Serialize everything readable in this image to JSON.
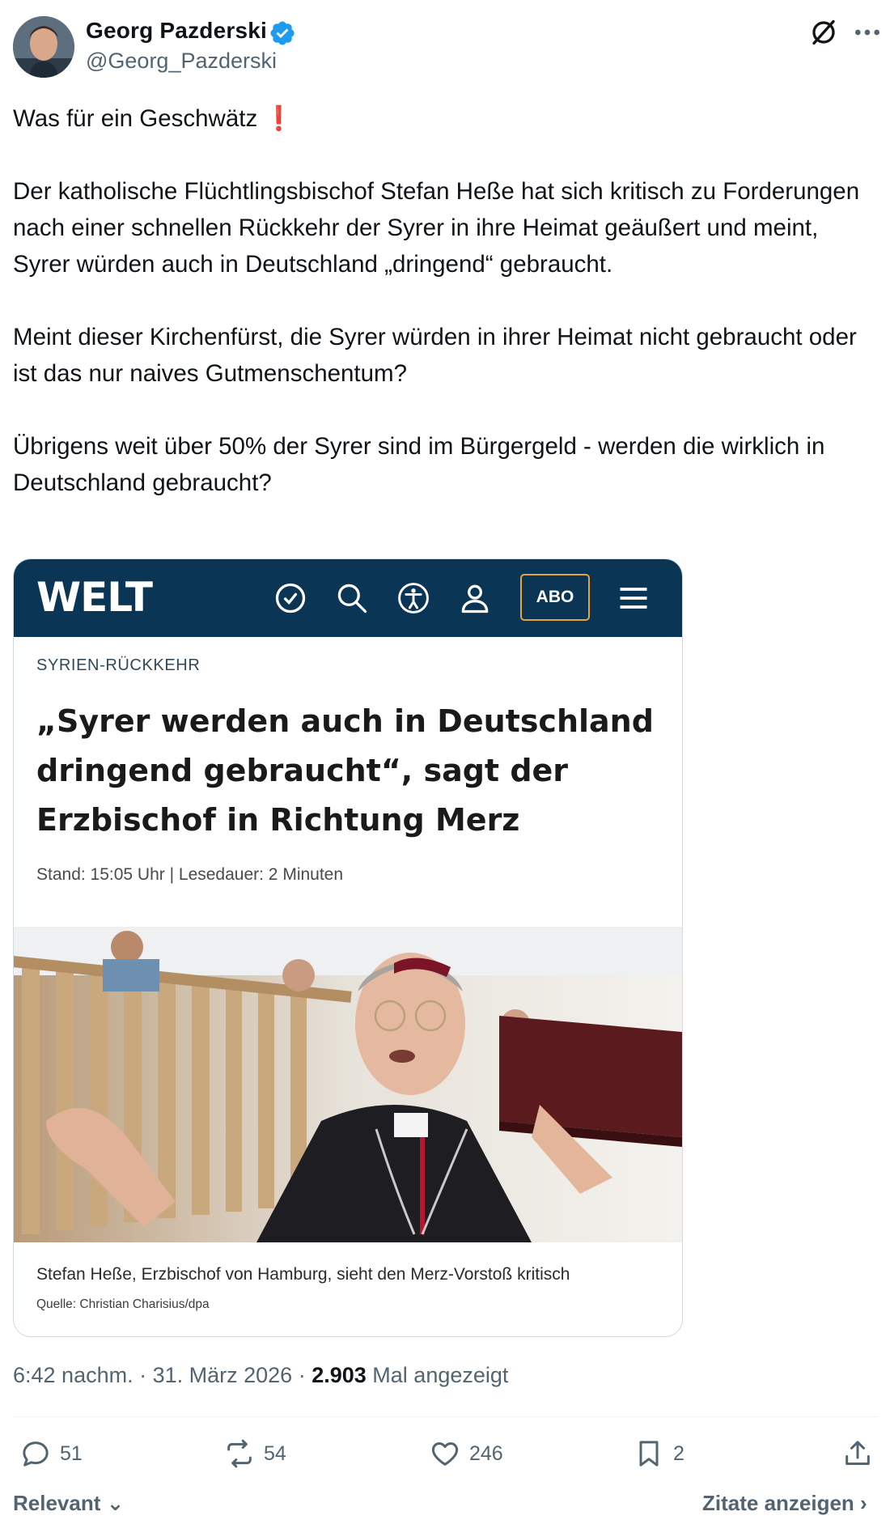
{
  "author": {
    "name": "Georg Pazderski",
    "handle": "@Georg_Pazderski",
    "avatar_icon": "profile-photo",
    "verified_color": "#1d9bf0"
  },
  "tweet": {
    "paragraphs": [
      "Was für ein Geschwätz ",
      "Der katholische Flüchtlingsbischof Stefan Heße hat sich kritisch zu Forderungen nach einer schnellen Rückkehr der Syrer in ihre Heimat geäußert und meint, Syrer würden auch in Deutschland „dringend“ gebraucht.",
      "Meint dieser Kirchenfürst, die Syrer würden in ihrer Heimat nicht gebraucht oder ist das nur naives Gutmenschentum?",
      "Übrigens weit über 50% der Syrer sind im Bürgergeld - werden die wirklich in Deutschland gebraucht?"
    ],
    "emoji": "❗"
  },
  "card": {
    "logo": "WELT",
    "abo_label": "ABO",
    "kicker": "SYRIEN-RÜCKKEHR",
    "headline": "„Syrer werden auch in Deutschland dringend gebraucht“, sagt der Erzbischof in Richtung Merz",
    "meta": "Stand: 15:05 Uhr | Lesedauer: 2 Minuten",
    "caption": "Stefan Heße, Erzbischof von Hamburg, sieht den Merz-Vorstoß kritisch",
    "source": "Quelle: Christian Charisius/dpa",
    "brand_color": "#0a3554",
    "accent_color": "#e8a33c"
  },
  "timestamp": {
    "time": "6:42 nachm.",
    "date": "31. März 2026",
    "views_count": "2.903",
    "views_label": "Mal angezeigt"
  },
  "actions": {
    "replies": "51",
    "reposts": "54",
    "likes": "246",
    "bookmarks": "2"
  },
  "footer": {
    "sort_label": "Relevant",
    "quotes_label": "Zitate anzeigen"
  }
}
